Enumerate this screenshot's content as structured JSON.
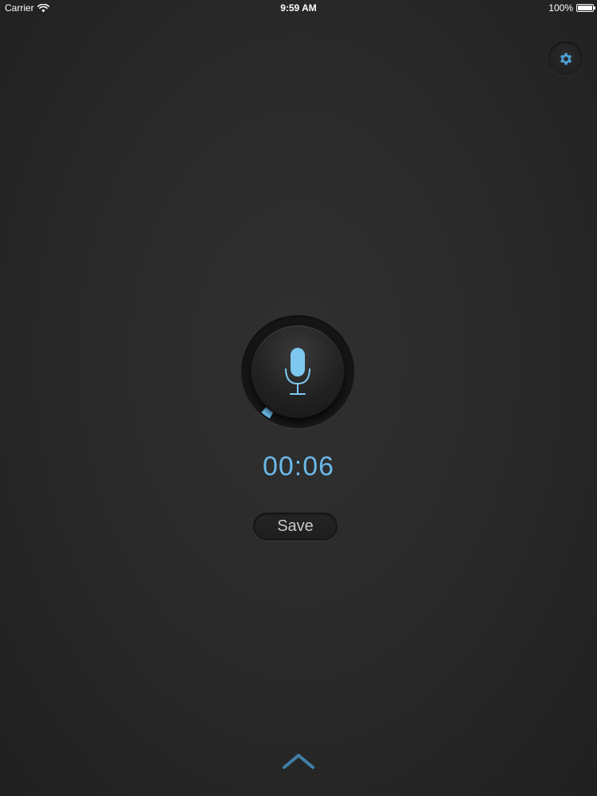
{
  "status_bar": {
    "carrier": "Carrier",
    "time": "9:59 AM",
    "battery": "100%"
  },
  "settings": {
    "icon": "gear-icon"
  },
  "recorder": {
    "icon": "microphone-icon",
    "elapsed": "00:06",
    "progress_fraction": 0.03,
    "save_label": "Save"
  },
  "footer": {
    "icon": "chevron-up-icon"
  },
  "colors": {
    "accent": "#6ab9e8",
    "background": "#282828"
  }
}
